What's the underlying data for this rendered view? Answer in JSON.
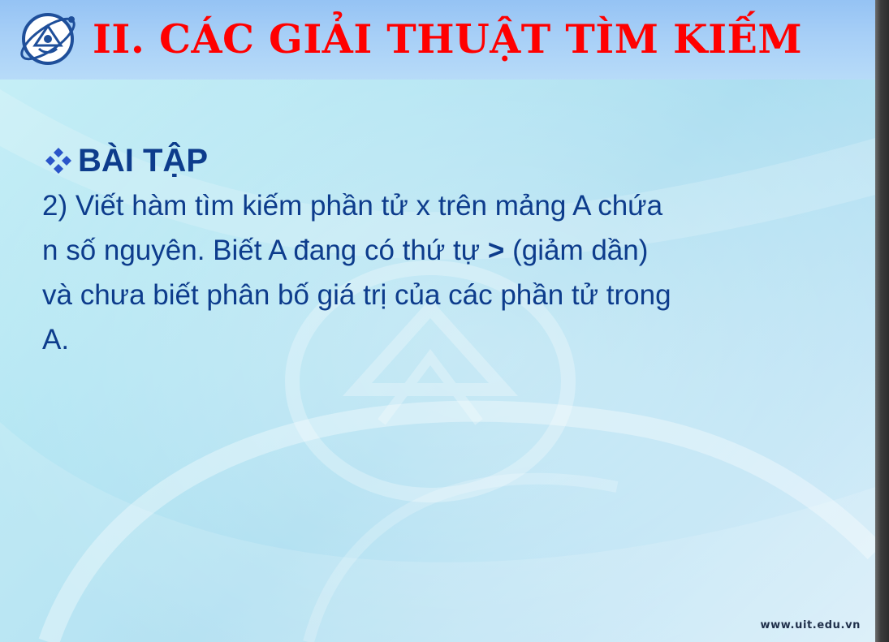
{
  "slide": {
    "title": "II. CÁC GIẢI THUẬT TÌM KIẾM",
    "section_heading": "BÀI TẬP",
    "body": {
      "line1": "2) Viết hàm tìm kiếm phần tử x trên mảng A chứa",
      "line2_before": "n số nguyên. Biết A đang có thứ tự ",
      "line2_operator": ">",
      "line2_after": " (giảm dần)",
      "line3": "và chưa biết phân bố giá trị của các phần tử trong",
      "line4": "A."
    },
    "footer_url": "www.uit.edu.vn"
  },
  "icons": {
    "logo": "university-logo-icon",
    "bullet": "diamond-bullet-icon"
  },
  "colors": {
    "title": "#ff0000",
    "text": "#0d3c8c",
    "title_bar": "#a7cff7",
    "background": "#b4e6f3"
  }
}
